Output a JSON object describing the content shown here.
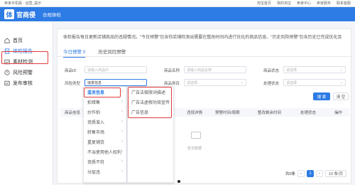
{
  "topbar": {
    "left": "卖家手机版 · 运营_提示",
    "links": [
      "淘宝首页",
      "我的淘宝",
      "卖家中心",
      "卖家服务",
      "联系客服"
    ]
  },
  "header": {
    "logo_glyph": "体",
    "logo_text": "官商侵",
    "subtitle": "合规体检"
  },
  "sidebar": {
    "items": [
      {
        "label": "首页",
        "icon": "home-icon"
      },
      {
        "label": "体检报告",
        "icon": "report-icon",
        "active": true
      },
      {
        "label": "素材检测",
        "icon": "image-icon"
      },
      {
        "label": "风险预警",
        "icon": "warning-icon"
      },
      {
        "label": "发布审核",
        "icon": "publish-icon"
      }
    ]
  },
  "main": {
    "notice": "体检报告每日更新店铺商品的违规情况。\"今日预警\"包含你店铺检测出需要在整改时间内进行优化的商品信息。\"历史风险预警\"包含历史已完成优化及",
    "tabs": [
      {
        "label": "今日预警 0"
      },
      {
        "label": "历史风险预警"
      }
    ],
    "filters": {
      "product_id": {
        "label": "商品ID",
        "placeholder": "请输入商品ID"
      },
      "product_name": {
        "label": "商品名称",
        "placeholder": "请输入商品名称"
      },
      "product_status": {
        "label": "商品状态",
        "placeholder": "请选择"
      },
      "risk_type": {
        "label": "风险类型",
        "value": "违发信息"
      },
      "product_category": {
        "label": "商品类目",
        "placeholder": "请选择"
      },
      "handle_status": {
        "label": "处理状态",
        "placeholder": "请选择"
      }
    },
    "search_button": "搜 索",
    "reset_button": "清 空",
    "table_headers": [
      "商品信息",
      "违规详情",
      "预警时间/周期",
      "整改剩余时间",
      "处理状态",
      "操作"
    ],
    "empty_text": "暂无数据",
    "pagination": {
      "total": "共0条",
      "current": "1",
      "page_size": "10 条/页"
    }
  },
  "risk_dropdown": {
    "level1": [
      "滥发信息",
      "拍错售",
      "炒作拍",
      "资质准入",
      "转售市场",
      "重复铺货",
      "不当使用他人权利",
      "资质不符",
      "分层违"
    ],
    "level2": [
      "广告法极限词描述",
      "广告法虚假功效宣传",
      "广告信息"
    ]
  },
  "colors": {
    "primary": "#2d7be5",
    "highlight": "#e23b3b"
  }
}
